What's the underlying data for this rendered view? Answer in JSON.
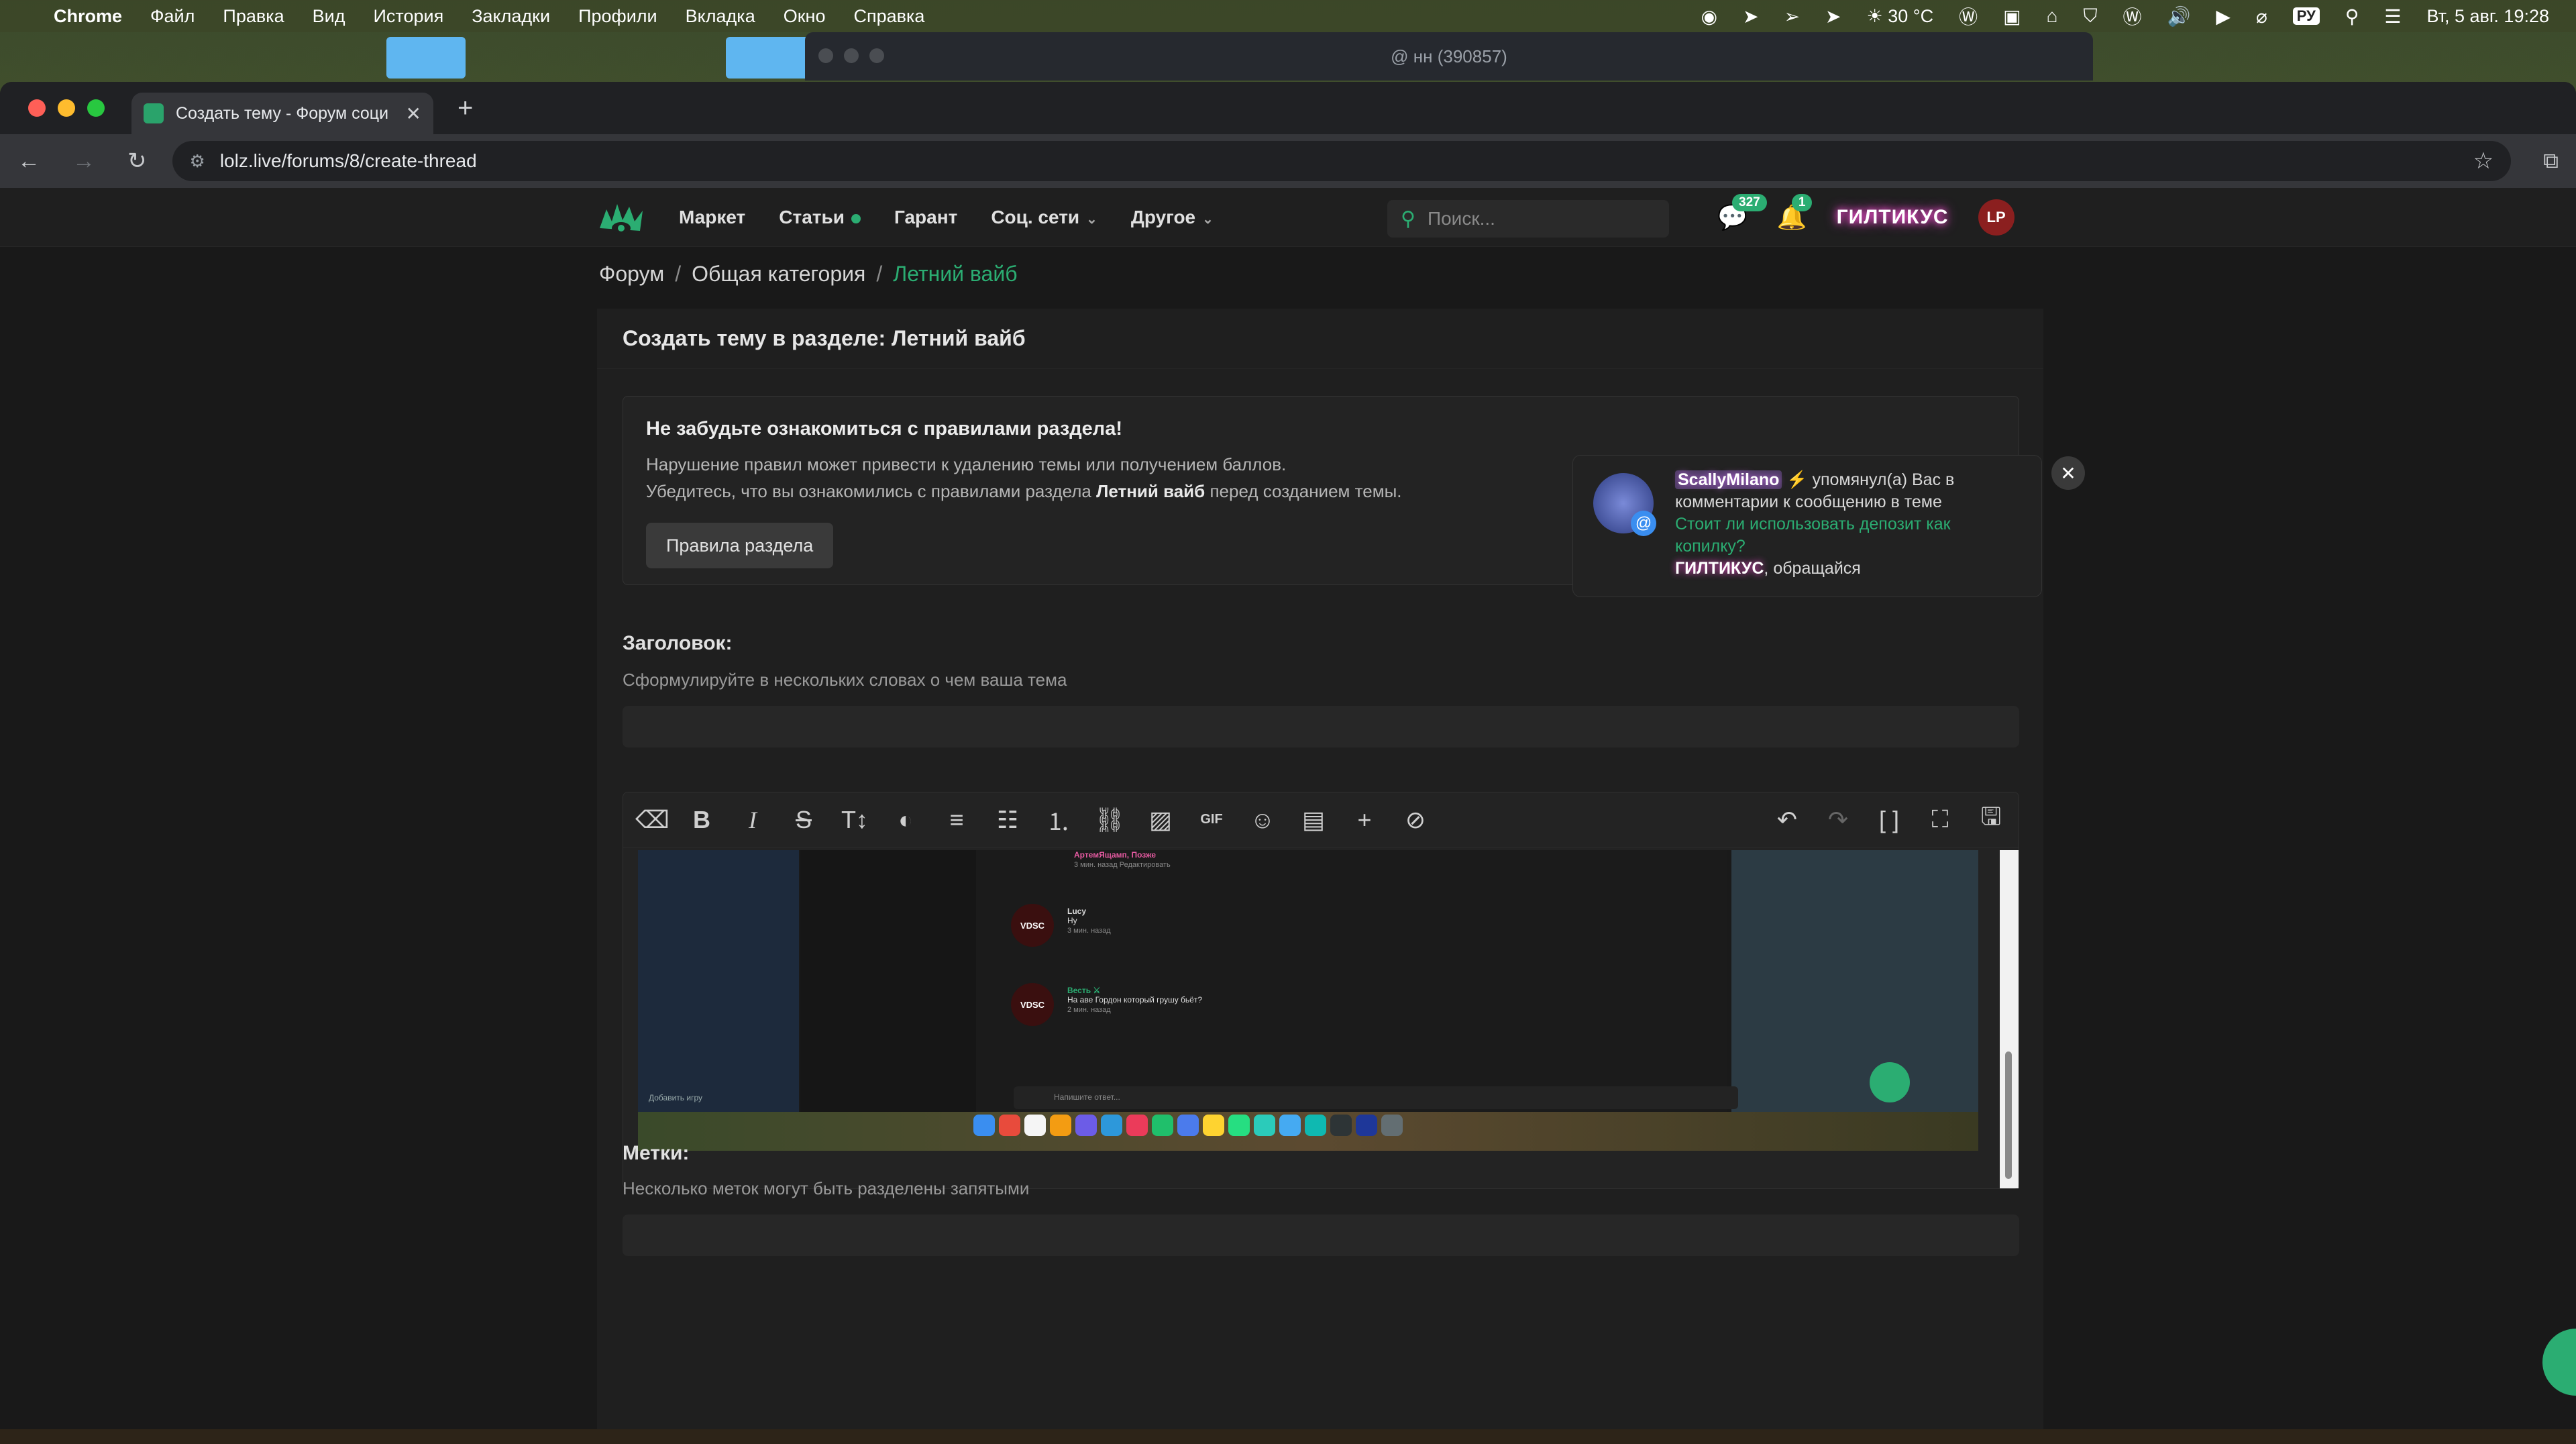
{
  "menubar": {
    "app": "Chrome",
    "items": [
      "Файл",
      "Правка",
      "Вид",
      "История",
      "Закладки",
      "Профили",
      "Вкладка",
      "Окно",
      "Справка"
    ],
    "weather": "30 °C",
    "input_source": "РУ",
    "clock": "Вт, 5 авг.  19:28"
  },
  "background_window": {
    "title": "@ нн (390857)"
  },
  "chrome": {
    "tab_title": "Создать тему - Форум соци",
    "url": "lolz.live/forums/8/create-thread"
  },
  "site": {
    "nav": {
      "links": [
        "Маркет",
        "Статьи",
        "Гарант",
        "Соц. сети",
        "Другое"
      ],
      "search_placeholder": "Поиск...",
      "messages_count": "327",
      "alerts_count": "1",
      "username": "ГИЛТИКУС",
      "avatar_text": "LP"
    },
    "breadcrumb": [
      "Форум",
      "Общая категория",
      "Летний вайб"
    ],
    "panel_title": "Создать тему в разделе: Летний вайб",
    "notice": {
      "title": "Не забудьте ознакомиться с правилами раздела!",
      "line1": "Нарушение правил может привести к удалению темы или получением баллов.",
      "line2_pre": "Убедитесь, что вы ознакомились с правилами раздела",
      "line2_bold": "Летний вайб",
      "line2_post": "перед созданием темы.",
      "button": "Правила раздела"
    },
    "title_field": {
      "label": "Заголовок:",
      "hint": "Сформулируйте в нескольких словах о чем ваша тема"
    },
    "tags_field": {
      "label": "Метки:",
      "hint": "Несколько меток могут быть разделены запятыми"
    },
    "embedded": {
      "top_comment": "АртемЯщамп, Позже",
      "top_meta": "3 мин. назад   Редактировать",
      "c1_user": "Lucy",
      "c1_text": "Ну",
      "c1_meta": "3 мин. назад",
      "c2_user": "Весть ⚔",
      "c2_text": "На аве Гордон который грушу бьёт?",
      "c2_meta": "2 мин. назад",
      "reply_placeholder": "Напишите ответ...",
      "add_game": "Добавить игру",
      "avatar_text": "VDSC"
    },
    "notification": {
      "user": "ScallyMilano",
      "text": "⚡ упомянул(а) Вас в комментарии к сообщению в теме",
      "thread": "Стоит ли использовать депозит как копилку?",
      "mention_user": "ГИЛТИКУС",
      "tail": ", обращайся"
    }
  },
  "colors": {
    "accent": "#2bad72",
    "panel": "#1f1f1f",
    "page": "#191919"
  }
}
